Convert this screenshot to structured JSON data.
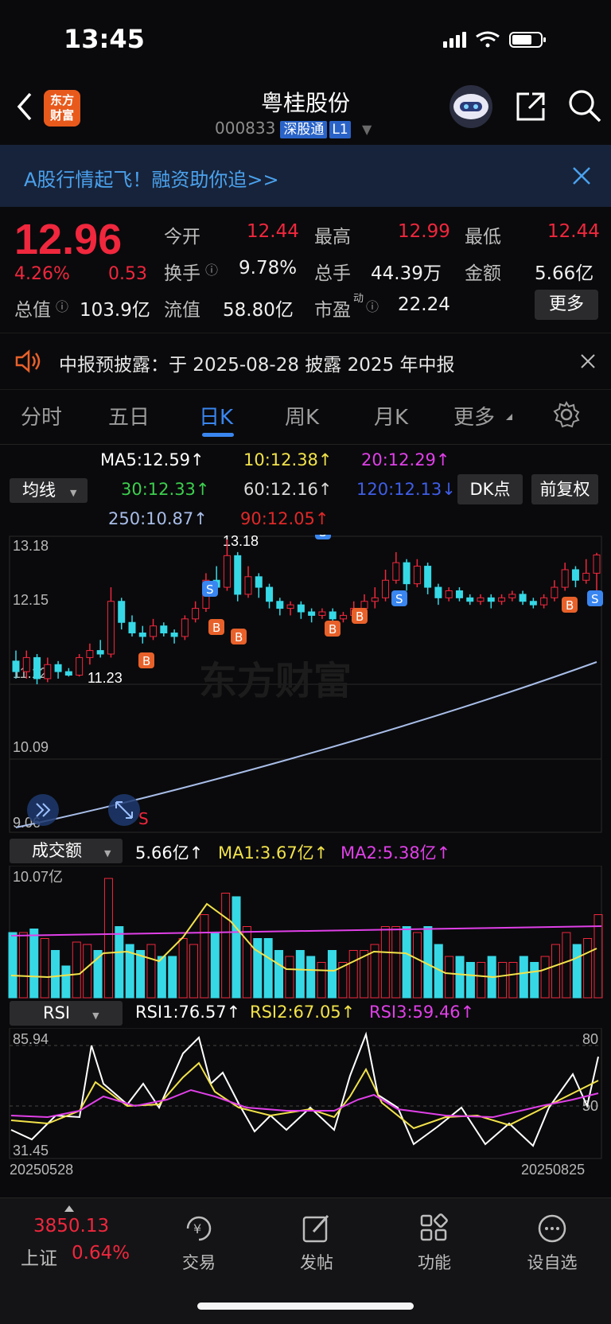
{
  "status": {
    "time": "13:45"
  },
  "header": {
    "title": "粤桂股份",
    "code": "000833",
    "tag": "深股通",
    "level": "L1",
    "logo": "东方财富"
  },
  "banner": {
    "text": "A股行情起飞！融资助你追>>"
  },
  "quote": {
    "price": "12.96",
    "change_pct": "4.26%",
    "change": "0.53",
    "open_label": "今开",
    "open": "12.44",
    "high_label": "最高",
    "high": "12.99",
    "low_label": "最低",
    "low": "12.44",
    "turnover_label": "换手",
    "turnover": "9.78%",
    "volume_label": "总手",
    "volume": "44.39万",
    "amount_label": "金额",
    "amount": "5.66亿",
    "total_cap_label": "总值",
    "total_cap": "103.9亿",
    "float_cap_label": "流值",
    "float_cap": "58.80亿",
    "pe_label": "市盈",
    "pe_sup": "动",
    "pe": "22.24",
    "more_label": "更多"
  },
  "notice": {
    "text": "中报预披露：于 2025-08-28 披露 2025 年中报"
  },
  "tabs": [
    "分时",
    "五日",
    "日K",
    "周K",
    "月K",
    "更多"
  ],
  "active_tab": "日K",
  "ma": {
    "selector": "均线",
    "ma5": "MA5:12.59↑",
    "ma10": "10:12.38↑",
    "ma20": "20:12.29↑",
    "ma30": "30:12.33↑",
    "ma60": "60:12.16↑",
    "ma120": "120:12.13↓",
    "ma250": "250:10.87↑",
    "ma90": "90:12.05↑",
    "dk_button": "DK点",
    "adj_button": "前复权"
  },
  "colors": {
    "up": "#f0273d",
    "down": "#36d8e6",
    "ma5": "#ffffff",
    "ma10": "#f2e24a",
    "ma20": "#e040e8",
    "ma30": "#3ccf4e",
    "ma60": "#d8d8d8",
    "ma120": "#3f5ee8",
    "ma250": "#a8bde8",
    "ma90": "#e02828"
  },
  "kline_axis": {
    "top": "13.18",
    "mid": "12.15",
    "low": "11.12",
    "l2": "10.09",
    "bottom": "9.06",
    "high_mark": "13.18",
    "low_mark": "11.23",
    "watermark": "东方财富"
  },
  "volume": {
    "selector": "成交额",
    "value": "5.66亿↑",
    "ma1": "MA1:3.67亿↑",
    "ma2": "MA2:5.38亿↑",
    "axis_top": "10.07亿"
  },
  "rsi": {
    "selector": "RSI",
    "rsi1": "RSI1:76.57↑",
    "rsi2": "RSI2:67.05↑",
    "rsi3": "RSI3:59.46↑",
    "axis_top": "85.94",
    "axis_bottom": "31.45",
    "ref80": "80",
    "ref50": "50",
    "date_start": "20250528",
    "date_end": "20250825"
  },
  "bottom_nav": {
    "index_value": "3850.13",
    "index_name": "上证",
    "index_change": "0.64%",
    "items": [
      "交易",
      "发帖",
      "功能",
      "设自选"
    ]
  },
  "chart_data": {
    "type": "candlestick",
    "x_start": "20250528",
    "x_end": "20250825",
    "ylim": [
      9.06,
      13.18
    ],
    "candles": [
      [
        11.45,
        11.3,
        11.6,
        11.2
      ],
      [
        11.3,
        11.5,
        11.6,
        11.2
      ],
      [
        11.5,
        11.2,
        11.55,
        11.12
      ],
      [
        11.2,
        11.4,
        11.5,
        11.15
      ],
      [
        11.4,
        11.3,
        11.45,
        11.2
      ],
      [
        11.3,
        11.25,
        11.35,
        11.23
      ],
      [
        11.25,
        11.5,
        11.55,
        11.23
      ],
      [
        11.5,
        11.6,
        11.7,
        11.4
      ],
      [
        11.6,
        11.55,
        11.75,
        11.5
      ],
      [
        11.55,
        12.3,
        12.5,
        11.5
      ],
      [
        12.3,
        12.0,
        12.35,
        11.9
      ],
      [
        12.0,
        11.85,
        12.1,
        11.8
      ],
      [
        11.85,
        11.8,
        11.95,
        11.7
      ],
      [
        11.8,
        11.95,
        12.05,
        11.75
      ],
      [
        11.95,
        11.85,
        12.0,
        11.8
      ],
      [
        11.85,
        11.8,
        11.9,
        11.7
      ],
      [
        11.8,
        12.05,
        12.1,
        11.75
      ],
      [
        12.05,
        12.2,
        12.3,
        12.0
      ],
      [
        12.2,
        12.6,
        12.7,
        12.15
      ],
      [
        12.6,
        12.5,
        12.8,
        12.4
      ],
      [
        12.5,
        12.95,
        13.18,
        12.45
      ],
      [
        12.95,
        12.4,
        13.0,
        12.3
      ],
      [
        12.4,
        12.65,
        12.8,
        12.35
      ],
      [
        12.65,
        12.5,
        12.7,
        12.35
      ],
      [
        12.5,
        12.3,
        12.55,
        12.2
      ],
      [
        12.3,
        12.2,
        12.35,
        12.1
      ],
      [
        12.2,
        12.25,
        12.3,
        12.1
      ],
      [
        12.25,
        12.15,
        12.3,
        12.05
      ],
      [
        12.15,
        12.1,
        12.2,
        12.0
      ],
      [
        12.1,
        12.15,
        12.2,
        12.05
      ],
      [
        12.15,
        12.05,
        12.2,
        11.95
      ],
      [
        12.05,
        12.1,
        12.15,
        12.0
      ],
      [
        12.1,
        12.2,
        12.3,
        12.05
      ],
      [
        12.2,
        12.3,
        12.4,
        12.15
      ],
      [
        12.3,
        12.35,
        12.5,
        12.2
      ],
      [
        12.35,
        12.6,
        12.75,
        12.3
      ],
      [
        12.6,
        12.85,
        13.0,
        12.55
      ],
      [
        12.85,
        12.55,
        12.9,
        12.45
      ],
      [
        12.55,
        12.8,
        12.9,
        12.5
      ],
      [
        12.8,
        12.5,
        12.85,
        12.4
      ],
      [
        12.5,
        12.35,
        12.55,
        12.25
      ],
      [
        12.35,
        12.45,
        12.5,
        12.3
      ],
      [
        12.45,
        12.35,
        12.5,
        12.3
      ],
      [
        12.35,
        12.3,
        12.4,
        12.25
      ],
      [
        12.3,
        12.35,
        12.4,
        12.25
      ],
      [
        12.35,
        12.3,
        12.4,
        12.2
      ],
      [
        12.3,
        12.35,
        12.4,
        12.25
      ],
      [
        12.35,
        12.4,
        12.45,
        12.3
      ],
      [
        12.4,
        12.3,
        12.45,
        12.25
      ],
      [
        12.3,
        12.25,
        12.35,
        12.2
      ],
      [
        12.25,
        12.35,
        12.4,
        12.2
      ],
      [
        12.35,
        12.5,
        12.6,
        12.3
      ],
      [
        12.5,
        12.75,
        12.85,
        12.45
      ],
      [
        12.75,
        12.6,
        12.8,
        12.5
      ],
      [
        12.6,
        12.7,
        12.9,
        12.55
      ],
      [
        12.7,
        12.96,
        12.99,
        12.44
      ]
    ]
  }
}
